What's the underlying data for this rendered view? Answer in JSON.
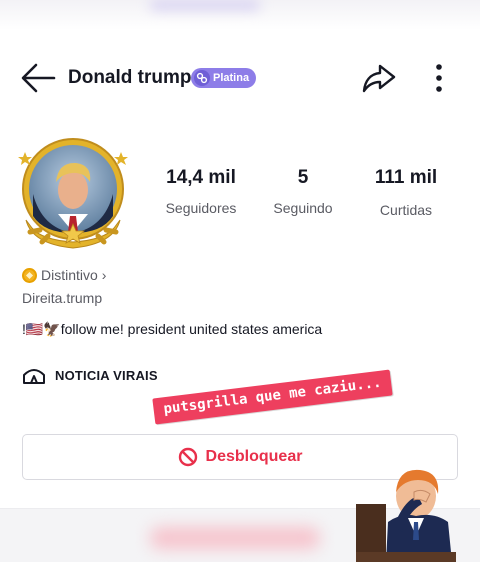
{
  "header": {
    "title": "Donald trump",
    "badge_label": "Platina"
  },
  "stats": [
    {
      "value": "14,4 mil",
      "label": "Seguidores"
    },
    {
      "value": "5",
      "label": "Seguindo"
    },
    {
      "value": "111 mil",
      "label": "Curtidas"
    }
  ],
  "profile": {
    "distintivo_label": "Distintivo",
    "distintivo_chevron": "›",
    "username": "Direita.trump",
    "bio": "!🇺🇸🦅follow me! president united states america"
  },
  "link": {
    "label": "NOTICIA VIRAIS",
    "icon": "tent-icon"
  },
  "sticker": {
    "text": "putsgrilla que me caziu..."
  },
  "actions": {
    "unblock_label": "Desbloquear"
  },
  "colors": {
    "accent_red": "#e8304b",
    "badge_purple": "#8d7de8",
    "sticker_pink": "#ee3f5e",
    "gold": "#e3b32a"
  }
}
